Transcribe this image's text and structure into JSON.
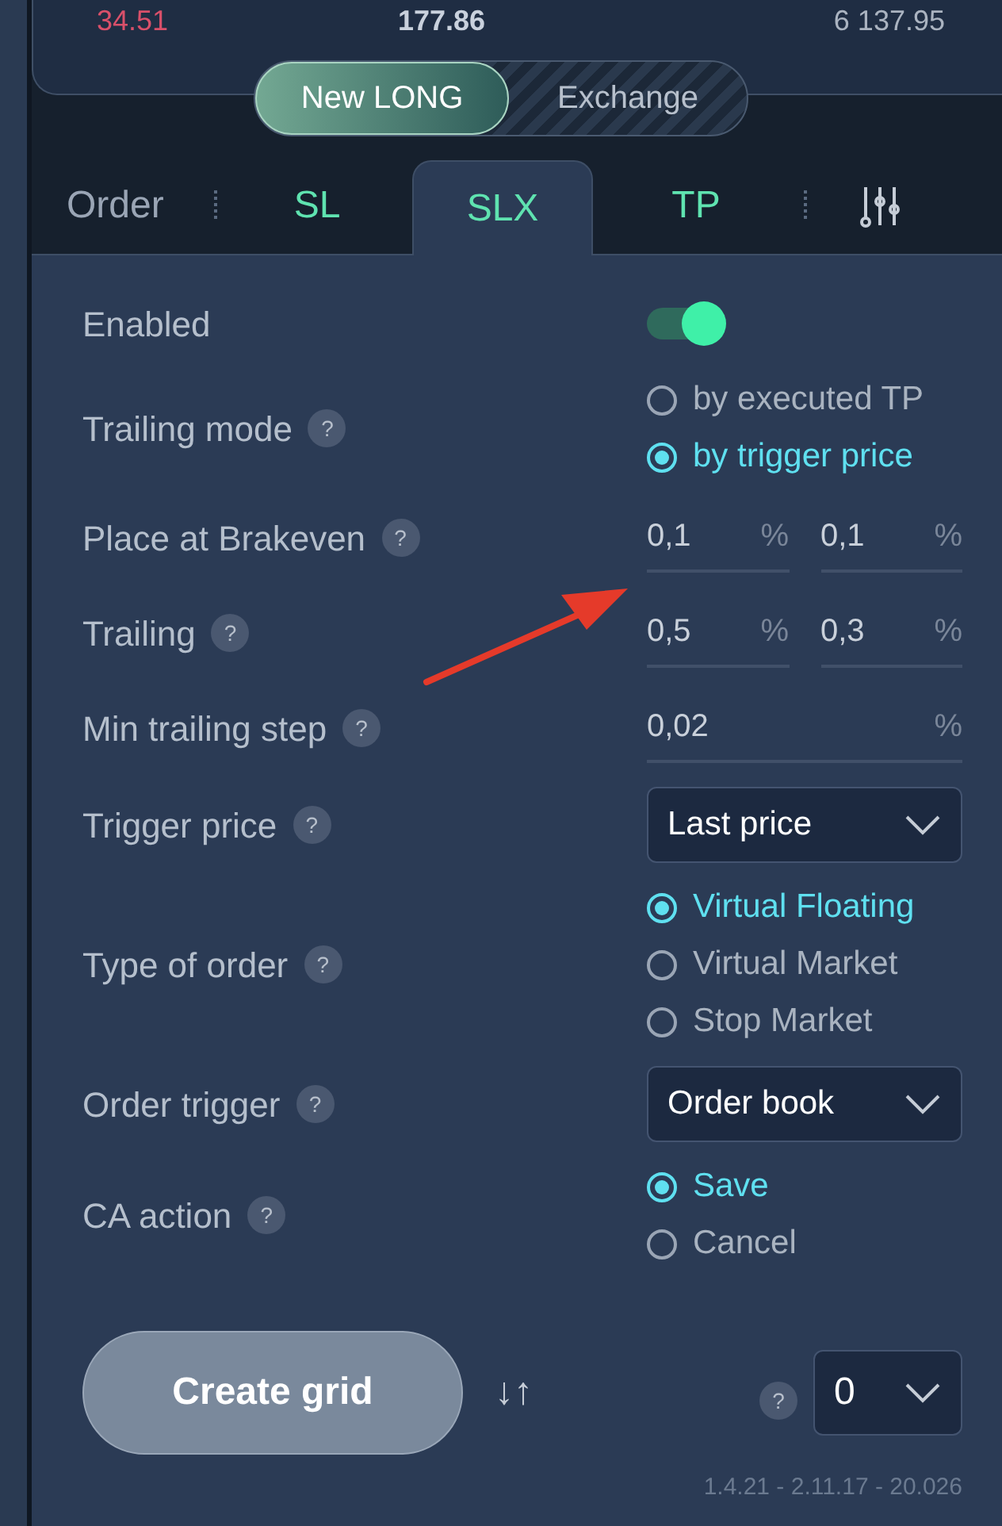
{
  "stats": [
    {
      "value": "34.51",
      "kind": "loss"
    },
    {
      "value": "177.86",
      "kind": "total"
    },
    {
      "value": "6 137.95",
      "kind": "plain"
    }
  ],
  "mode_switch": [
    {
      "label": "New LONG",
      "selected": true
    },
    {
      "label": "Exchange",
      "selected": false
    }
  ],
  "tabs": [
    {
      "label": "Order",
      "kind": "plain",
      "selected": false
    },
    {
      "kind": "separator"
    },
    {
      "label": "SL",
      "kind": "accent",
      "selected": false
    },
    {
      "label": "SLX",
      "kind": "accent",
      "selected": true
    },
    {
      "label": "TP",
      "kind": "accent",
      "selected": false
    },
    {
      "kind": "separator"
    },
    {
      "kind": "icon",
      "selected": false
    }
  ],
  "settings": [
    {
      "label": "Enabled",
      "kind": "toggle",
      "on": true
    },
    {
      "label": "Trailing mode",
      "help": "?",
      "kind": "radio",
      "options": [
        {
          "label": "by executed TP",
          "selected": false
        },
        {
          "label": "by trigger price",
          "selected": true
        }
      ]
    },
    {
      "label": "Place at Brakeven",
      "help": "?",
      "kind": "pair",
      "fields": [
        {
          "value": "0,1",
          "unit": "%"
        },
        {
          "value": "0,1",
          "unit": "%"
        }
      ]
    },
    {
      "label": "Trailing",
      "help": "?",
      "kind": "pair",
      "fields": [
        {
          "value": "0,5",
          "unit": "%"
        },
        {
          "value": "0,3",
          "unit": "%"
        }
      ]
    },
    {
      "label": "Min trailing step",
      "help": "?",
      "kind": "pair",
      "fields": [
        {
          "value": "0,02",
          "unit": "%"
        }
      ]
    },
    {
      "label": "Trigger price",
      "help": "?",
      "kind": "select",
      "value": "Last price"
    },
    {
      "label": "Type of order",
      "help": "?",
      "kind": "radio",
      "options": [
        {
          "label": "Virtual Floating",
          "selected": true
        },
        {
          "label": "Virtual Market",
          "selected": false
        },
        {
          "label": "Stop Market",
          "selected": false
        }
      ]
    },
    {
      "label": "Order trigger",
      "help": "?",
      "kind": "select",
      "value": "Order book"
    },
    {
      "label": "CA action",
      "help": "?",
      "kind": "radio",
      "options": [
        {
          "label": "Save",
          "selected": true
        },
        {
          "label": "Cancel",
          "selected": false
        }
      ]
    }
  ],
  "footer": {
    "button": "Create grid",
    "arrows": "↓↑",
    "help": "?",
    "count": "0",
    "version": "1.4.21 - 2.11.17 - 20.026"
  }
}
